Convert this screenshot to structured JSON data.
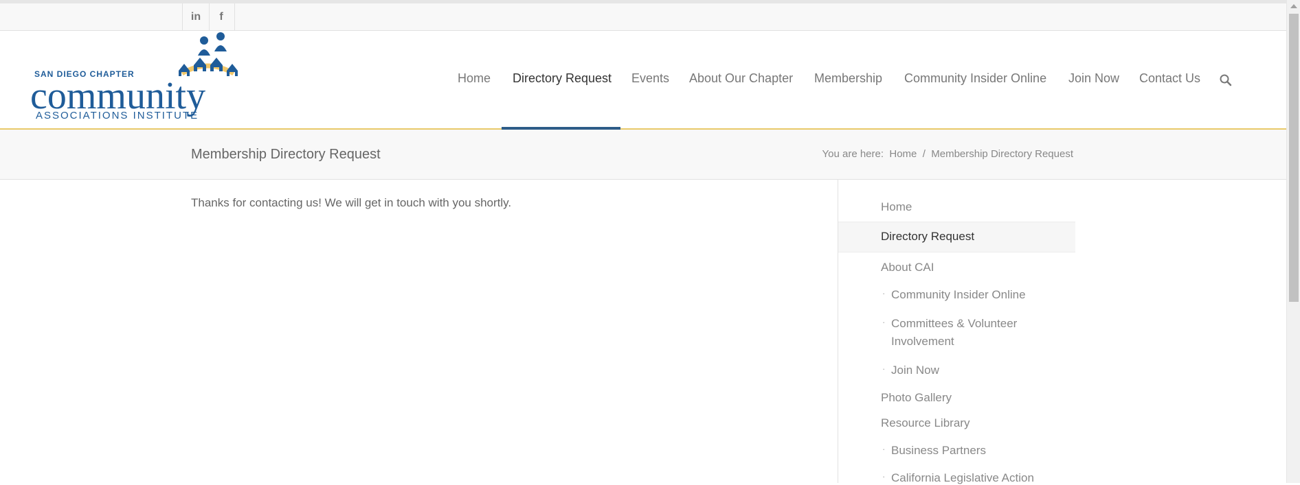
{
  "social": {
    "linkedin_label": "in",
    "facebook_label": "f"
  },
  "logo": {
    "line1": "SAN DIEGO CHAPTER",
    "line2": "community",
    "line3": "ASSOCIATIONS INSTITUTE",
    "brand_color": "#1f5c99",
    "accent_color": "#f2c86b"
  },
  "nav": {
    "items": [
      {
        "label": "Home"
      },
      {
        "label": "Directory Request"
      },
      {
        "label": "Events"
      },
      {
        "label": "About Our Chapter"
      },
      {
        "label": "Membership"
      },
      {
        "label": "Community Insider Online"
      },
      {
        "label": "Join Now"
      },
      {
        "label": "Contact Us"
      }
    ],
    "active_index": 1,
    "active_color": "#2d5c88"
  },
  "titlebar": {
    "title": "Membership Directory Request",
    "breadcrumb_prefix": "You are here:",
    "breadcrumb_home": "Home",
    "breadcrumb_sep": "/",
    "breadcrumb_current": "Membership Directory Request"
  },
  "content": {
    "message": "Thanks for contacting us! We will get in touch with you shortly."
  },
  "sidebar": {
    "items": [
      {
        "label": "Home",
        "sub": false
      },
      {
        "label": "Directory Request",
        "sub": false,
        "active": true
      },
      {
        "label": "About CAI",
        "sub": false
      },
      {
        "label": "Community Insider Online",
        "sub": true
      },
      {
        "label": "Committees & Volunteer Involvement",
        "sub": true
      },
      {
        "label": "Join Now",
        "sub": true
      },
      {
        "label": "Photo Gallery",
        "sub": false
      },
      {
        "label": "Resource Library",
        "sub": false
      },
      {
        "label": "Business Partners",
        "sub": true
      },
      {
        "label": "California Legislative Action",
        "sub": true
      }
    ]
  }
}
